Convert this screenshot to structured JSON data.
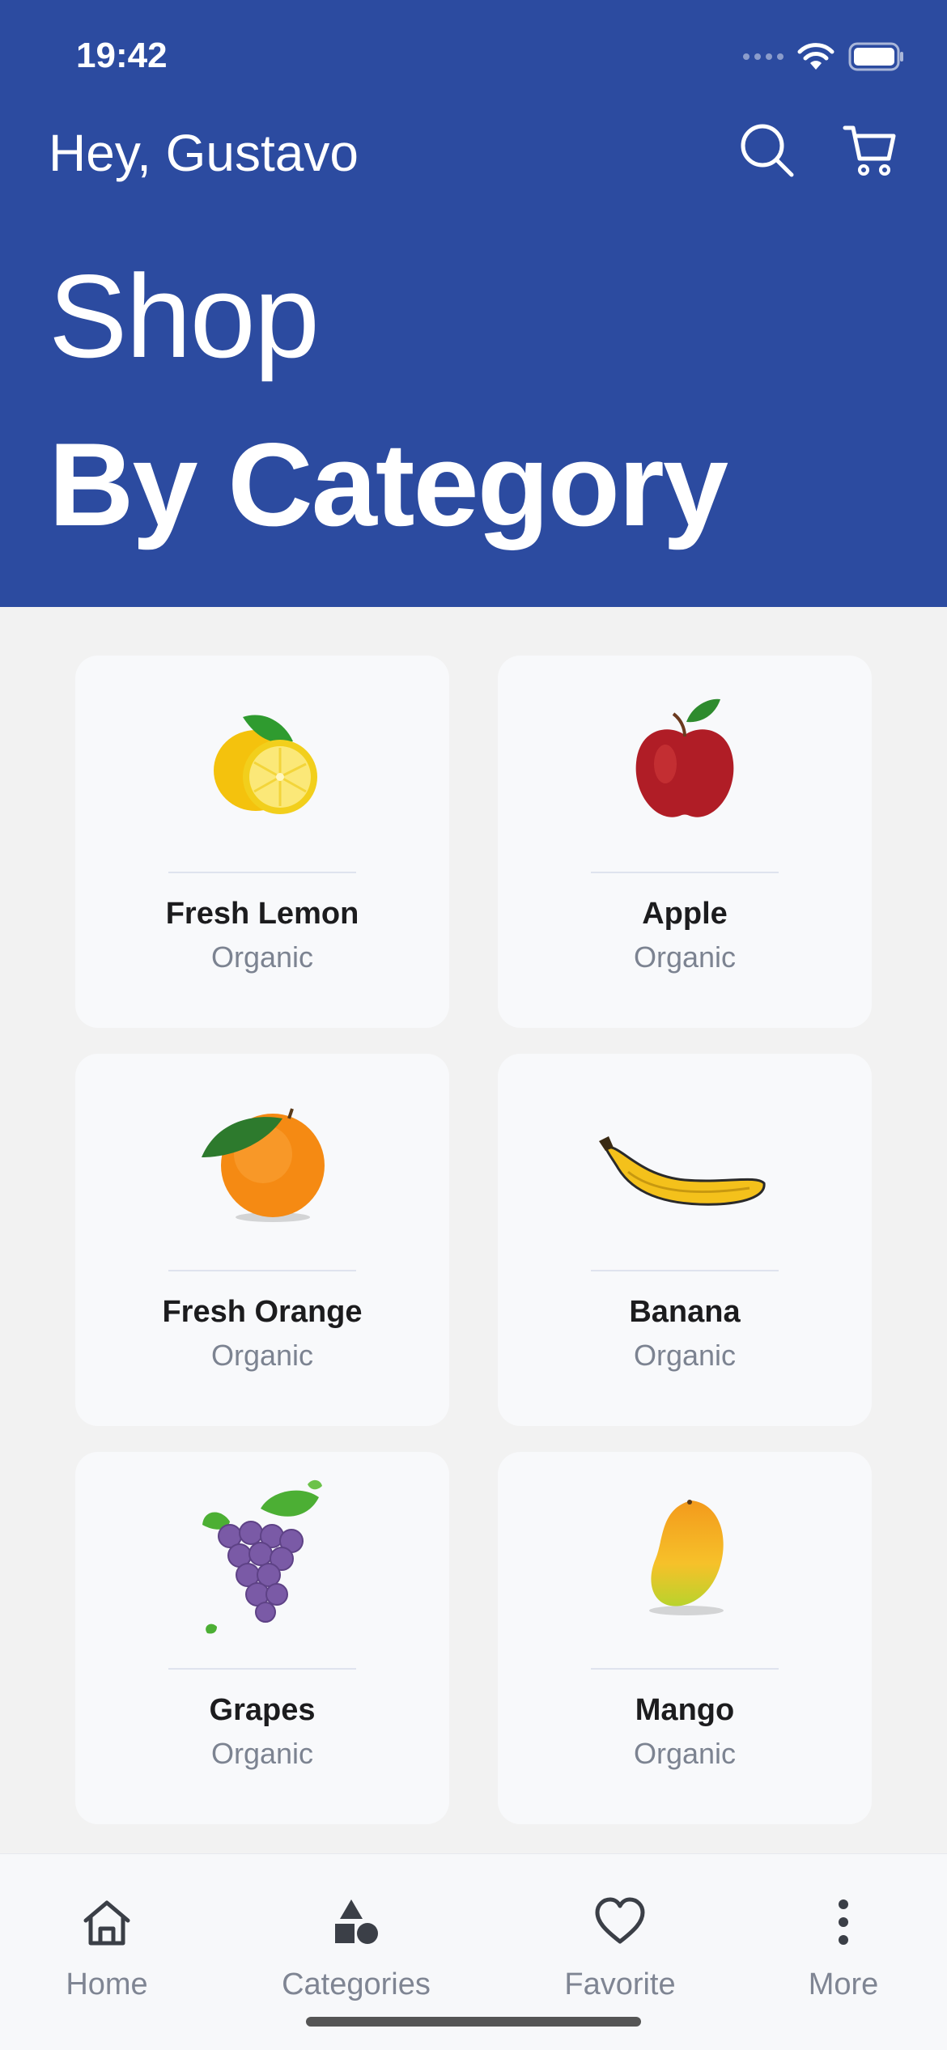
{
  "status_bar": {
    "time": "19:42"
  },
  "header": {
    "greeting": "Hey, Gustavo",
    "title_light": "Shop",
    "title_bold": "By Category"
  },
  "categories": [
    {
      "name": "Fresh Lemon",
      "subtitle": "Organic",
      "icon": "lemon-image"
    },
    {
      "name": "Apple",
      "subtitle": "Organic",
      "icon": "apple-image"
    },
    {
      "name": "Fresh Orange",
      "subtitle": "Organic",
      "icon": "orange-image"
    },
    {
      "name": "Banana",
      "subtitle": "Organic",
      "icon": "banana-image"
    },
    {
      "name": "Grapes",
      "subtitle": "Organic",
      "icon": "grapes-image"
    },
    {
      "name": "Mango",
      "subtitle": "Organic",
      "icon": "mango-image"
    }
  ],
  "tabbar": {
    "items": [
      {
        "label": "Home",
        "icon": "home-icon"
      },
      {
        "label": "Categories",
        "icon": "categories-icon"
      },
      {
        "label": "Favorite",
        "icon": "heart-icon"
      },
      {
        "label": "More",
        "icon": "more-icon"
      }
    ]
  },
  "colors": {
    "header_bg": "#2c4ba0",
    "page_bg": "#f2f2f2",
    "card_bg": "#f8f9fb",
    "tab_label": "#7f8593"
  }
}
